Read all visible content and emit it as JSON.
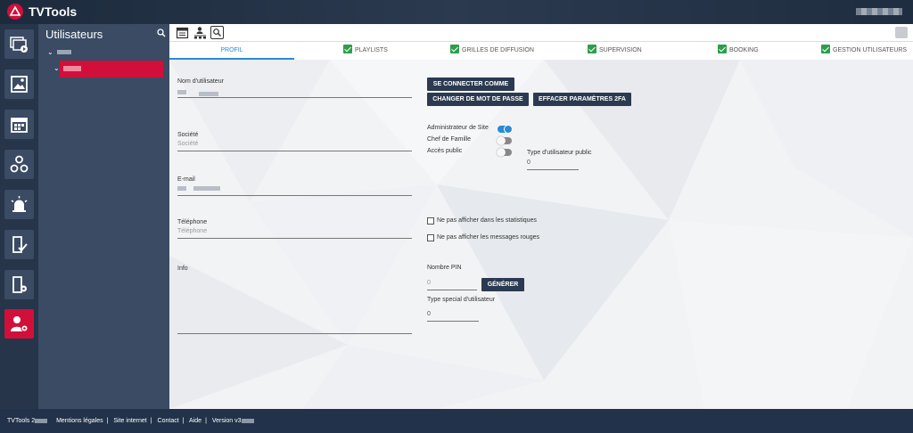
{
  "app": {
    "title": "TVTools"
  },
  "tree": {
    "title": "Utilisateurs"
  },
  "tabs": [
    {
      "label": "Profil",
      "active": true,
      "checked": false
    },
    {
      "label": "Playlists",
      "active": false,
      "checked": true
    },
    {
      "label": "Grilles de diffusion",
      "active": false,
      "checked": true
    },
    {
      "label": "Supervision",
      "active": false,
      "checked": true
    },
    {
      "label": "Booking",
      "active": false,
      "checked": true
    },
    {
      "label": "Gestion utilisateurs",
      "active": false,
      "checked": true
    }
  ],
  "form": {
    "username_label": "Nom d'utilisateur",
    "societe_label": "Société",
    "societe_placeholder": "Société",
    "email_label": "E-mail",
    "telephone_label": "Téléphone",
    "telephone_placeholder": "Téléphone",
    "info_label": "Info",
    "connect_as_button": "SE CONNECTER COMME",
    "change_password_button": "CHANGER DE MOT DE PASSE",
    "clear_2fa_button": "EFFACER PARAMÈTRES 2FA",
    "site_admin_label": "Administrateur de Site",
    "site_admin_on": true,
    "family_head_label": "Chef de Famille",
    "family_head_on": false,
    "public_access_label": "Accès public",
    "public_access_on": false,
    "public_user_type_label": "Type d'utilisateur public",
    "public_user_type_value": "0",
    "hide_stats_label": "Ne pas afficher dans les statistiques",
    "hide_red_messages_label": "Ne pas afficher les messages rouges",
    "pin_label": "Nombre PIN",
    "pin_placeholder": "0",
    "generate_button": "GÉNÉRER",
    "special_user_type_label": "Type special d'utilisateur",
    "special_user_type_value": "0"
  },
  "footer": {
    "brand": "TVTools 2",
    "legal": "Mentions légales",
    "website": "Site internet",
    "contact": "Contact",
    "help": "Aide",
    "version": "Version v3"
  },
  "colors": {
    "accent": "#d0103a",
    "primary": "#2a8ad4",
    "check": "#2e9e4a",
    "dark": "#2b3a50"
  }
}
